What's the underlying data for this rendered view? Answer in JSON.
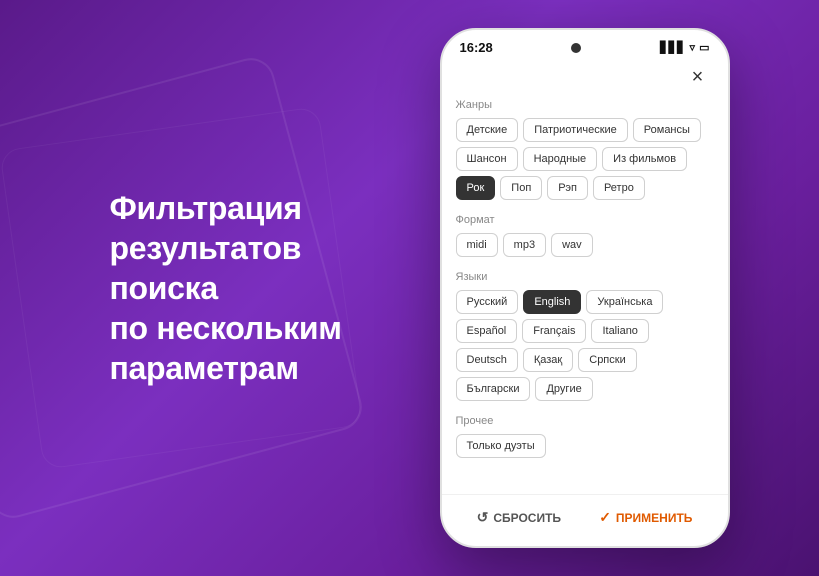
{
  "background": {
    "gradient_start": "#5a1a8a",
    "gradient_end": "#4a1270"
  },
  "headline": {
    "line1": "Фильтрация",
    "line2": "результатов поиска",
    "line3": "по нескольким",
    "line4": "параметрам"
  },
  "phone": {
    "status_time": "16:28",
    "close_label": "×",
    "sections": [
      {
        "id": "genres",
        "label": "Жанры",
        "tags": [
          {
            "text": "Детские",
            "active": false
          },
          {
            "text": "Патриотические",
            "active": false
          },
          {
            "text": "Романсы",
            "active": false
          },
          {
            "text": "Шансон",
            "active": false
          },
          {
            "text": "Народные",
            "active": false
          },
          {
            "text": "Из фильмов",
            "active": false
          },
          {
            "text": "Рок",
            "active": true
          },
          {
            "text": "Поп",
            "active": false
          },
          {
            "text": "Рэп",
            "active": false
          },
          {
            "text": "Ретро",
            "active": false
          }
        ]
      },
      {
        "id": "format",
        "label": "Формат",
        "tags": [
          {
            "text": "midi",
            "active": false
          },
          {
            "text": "mp3",
            "active": false
          },
          {
            "text": "wav",
            "active": false
          }
        ]
      },
      {
        "id": "languages",
        "label": "Языки",
        "tags": [
          {
            "text": "Русский",
            "active": false
          },
          {
            "text": "English",
            "active": true
          },
          {
            "text": "Українська",
            "active": false
          },
          {
            "text": "Español",
            "active": false
          },
          {
            "text": "Français",
            "active": false
          },
          {
            "text": "Italiano",
            "active": false
          },
          {
            "text": "Deutsch",
            "active": false
          },
          {
            "text": "Қазақ",
            "active": false
          },
          {
            "text": "Српски",
            "active": false
          },
          {
            "text": "Български",
            "active": false
          },
          {
            "text": "Другие",
            "active": false
          }
        ]
      },
      {
        "id": "other",
        "label": "Прочее",
        "tags": [
          {
            "text": "Только дуэты",
            "active": false
          }
        ]
      }
    ],
    "footer": {
      "reset_label": "СБРОСИТЬ",
      "apply_label": "ПРИМЕНИТЬ"
    }
  }
}
